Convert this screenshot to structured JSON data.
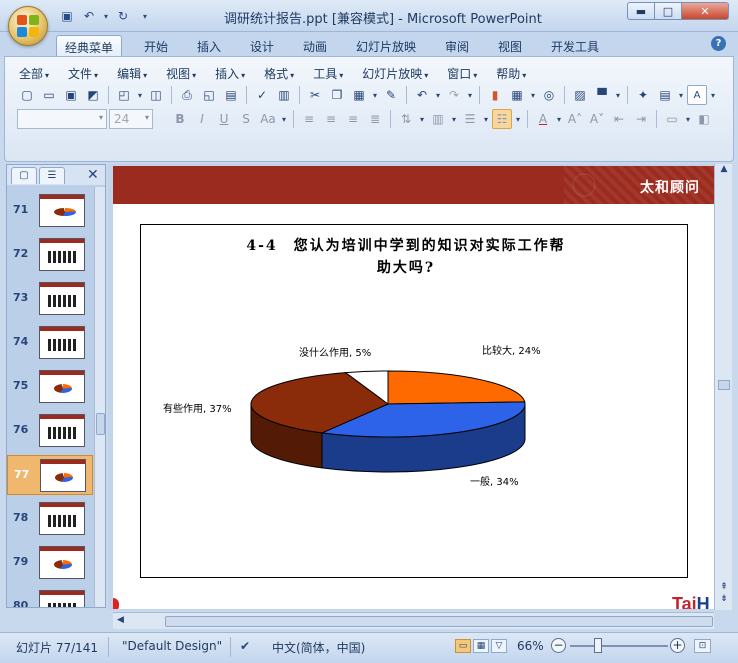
{
  "window": {
    "title": "调研统计报告.ppt [兼容模式] - Microsoft PowerPoint",
    "min_icon": "minimize-icon",
    "max_icon": "maximize-icon",
    "close_icon": "close-icon"
  },
  "ribbon_tabs": [
    "经典菜单",
    "开始",
    "插入",
    "设计",
    "动画",
    "幻灯片放映",
    "审阅",
    "视图",
    "开发工具"
  ],
  "menu_items": [
    "全部",
    "文件",
    "编辑",
    "视图",
    "插入",
    "格式",
    "工具",
    "幻灯片放映",
    "窗口",
    "帮助"
  ],
  "font": {
    "name_value": "",
    "size_value": "24"
  },
  "slides_panel": {
    "thumbnails": [
      {
        "num": "71"
      },
      {
        "num": "72"
      },
      {
        "num": "73"
      },
      {
        "num": "74"
      },
      {
        "num": "75"
      },
      {
        "num": "76"
      },
      {
        "num": "77"
      },
      {
        "num": "78"
      },
      {
        "num": "79"
      },
      {
        "num": "80"
      }
    ],
    "selected": "77"
  },
  "slide": {
    "brand": "太和顾问",
    "footer_logo_a": "Tai",
    "footer_logo_b": "H",
    "chart_title_line1": "4-4　您认为培训中学到的知识对实际工作帮",
    "chart_title_line2": "助大吗?"
  },
  "chart_data": {
    "type": "pie",
    "title": "4-4　您认为培训中学到的知识对实际工作帮助大吗?",
    "slices": [
      {
        "label": "比较大, 24%",
        "name": "比较大",
        "value": 24,
        "color": "#ff6a00"
      },
      {
        "label": "一般, 34%",
        "name": "一般",
        "value": 34,
        "color": "#2d63e8"
      },
      {
        "label": "有些作用, 37%",
        "name": "有些作用",
        "value": 37,
        "color": "#8a2b0a"
      },
      {
        "label": "没什么作用, 5%",
        "name": "没什么作用",
        "value": 5,
        "color": "#ffffff"
      }
    ],
    "style": "3d-pie"
  },
  "statusbar": {
    "slide_info": "幻灯片 77/141",
    "theme": "\"Default Design\"",
    "language": "中文(简体，中国)",
    "zoom": "66%"
  }
}
